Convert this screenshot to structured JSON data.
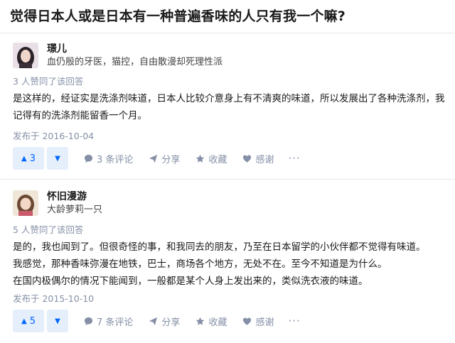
{
  "question": {
    "title": "觉得日本人或是日本有一种普遍香味的人只有我一个嘛?"
  },
  "answers": [
    {
      "author_name": "璟儿",
      "author_bio": "血仍殷的牙医，猫控，自由散漫却死理性派",
      "upvote_note": "3 人赞同了该回答",
      "content": [
        "是这样的，经证实是洗涤剂味道，日本人比较介意身上有不清爽的味道，所以发展出了各种洗涤剂，我记得有的洗涤剂能留香一个月。"
      ],
      "date": "发布于 2016-10-04",
      "vote_count": "3",
      "comment_label": "3 条评论",
      "share_label": "分享",
      "collect_label": "收藏",
      "thanks_label": "感谢",
      "more_label": "···"
    },
    {
      "author_name": "怀旧漫游",
      "author_bio": "大龄萝莉一只",
      "upvote_note": "5 人赞同了该回答",
      "content": [
        "是的，我也闻到了。但很奇怪的事，和我同去的朋友，乃至在日本留学的小伙伴都不觉得有味道。",
        "我感觉，那种香味弥漫在地铁，巴士，商场各个地方，无处不在。至今不知道是为什么。",
        "在国内极偶尔的情况下能闻到，一般都是某个人身上发出来的，类似洗衣液的味道。"
      ],
      "date": "发布于 2015-10-10",
      "vote_count": "5",
      "comment_label": "7 条评论",
      "share_label": "分享",
      "collect_label": "收藏",
      "thanks_label": "感谢",
      "more_label": "···"
    }
  ],
  "icons": {
    "upvote": "triangle-up-icon",
    "downvote": "triangle-down-icon",
    "comment": "comment-bubble-icon",
    "share": "paper-plane-icon",
    "collect": "star-icon",
    "thanks": "heart-icon"
  },
  "colors": {
    "accent": "#0066ff",
    "vote_bg": "#e5eefb",
    "meta": "#8590a6"
  }
}
